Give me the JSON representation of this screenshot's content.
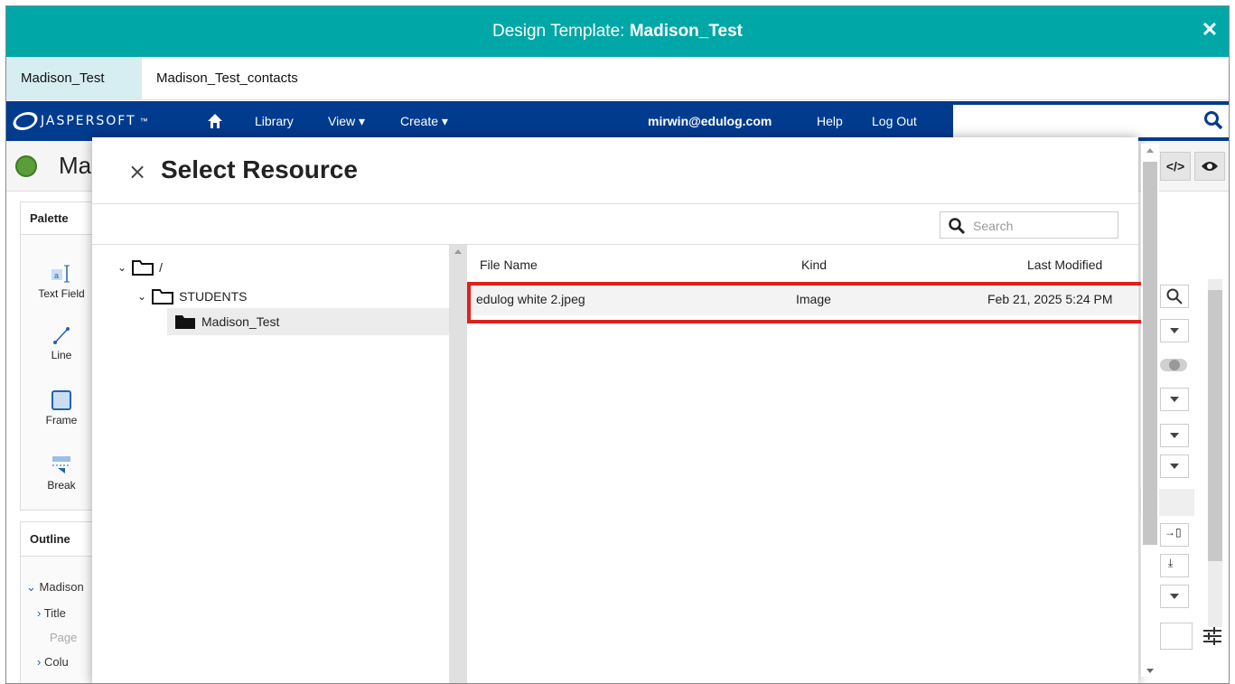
{
  "window": {
    "title_prefix": "Design Template: ",
    "title_name": "Madison_Test",
    "close_label": "✕"
  },
  "tabs": [
    {
      "label": "Madison_Test"
    },
    {
      "label": "Madison_Test_contacts"
    }
  ],
  "nav": {
    "logo_text": "JASPERSOFT",
    "logo_tm": "™",
    "library": "Library",
    "view": "View",
    "create": "Create",
    "user": "mirwin@edulog.com",
    "help": "Help",
    "logout": "Log Out"
  },
  "app": {
    "title": "Ma"
  },
  "palette": {
    "header": "Palette",
    "items": [
      {
        "label": "Text Field"
      },
      {
        "label": "Line"
      },
      {
        "label": "Frame"
      },
      {
        "label": "Break"
      }
    ]
  },
  "outline": {
    "header": "Outline",
    "items": [
      {
        "label": "Madison"
      },
      {
        "label": "Title"
      },
      {
        "label": "Page"
      },
      {
        "label": "Colu"
      }
    ]
  },
  "modal": {
    "close_label": "×",
    "title": "Select Resource",
    "search_placeholder": "Search",
    "tree": [
      {
        "label": "/"
      },
      {
        "label": "STUDENTS"
      },
      {
        "label": "Madison_Test"
      }
    ],
    "columns": {
      "file_name": "File Name",
      "kind": "Kind",
      "last_modified": "Last Modified"
    },
    "files": [
      {
        "name": "edulog white 2.jpeg",
        "kind": "Image",
        "modified": "Feb 21, 2025 5:24 PM"
      }
    ]
  },
  "colors": {
    "title_bar": "#00a7a7",
    "nav_bar": "#003b8e",
    "highlight": "#e0201b"
  }
}
